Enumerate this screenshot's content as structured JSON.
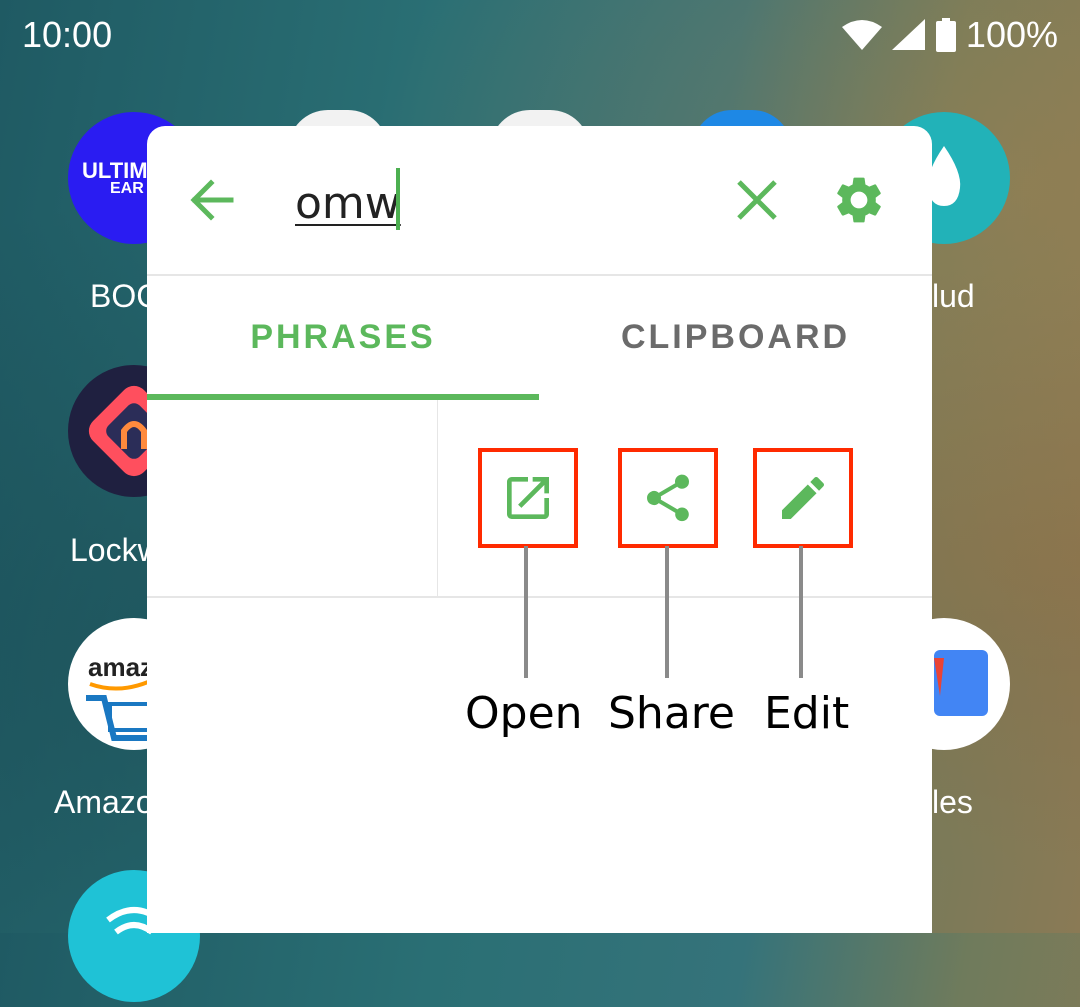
{
  "status_bar": {
    "time": "10:00",
    "battery": "100%"
  },
  "launcher": {
    "labels": [
      "BOC",
      "Lockw",
      "Amazo",
      "lud",
      "les"
    ],
    "icon_texts": {
      "ultimate": "ULTIM",
      "ultimate_sub": "EAR",
      "amazon": "amaz"
    }
  },
  "panel": {
    "search": {
      "value": "omw"
    },
    "tabs": [
      {
        "label": "PHRASES",
        "active": true
      },
      {
        "label": "CLIPBOARD",
        "active": false
      }
    ],
    "actions": [
      {
        "name": "open",
        "icon": "open-in-new-icon",
        "label": "Open"
      },
      {
        "name": "share",
        "icon": "share-icon",
        "label": "Share"
      },
      {
        "name": "edit",
        "icon": "pencil-icon",
        "label": "Edit"
      }
    ]
  },
  "colors": {
    "accent": "#5cb85c",
    "highlight": "#ff2a00",
    "inactive_tab": "#6b6b6b"
  }
}
